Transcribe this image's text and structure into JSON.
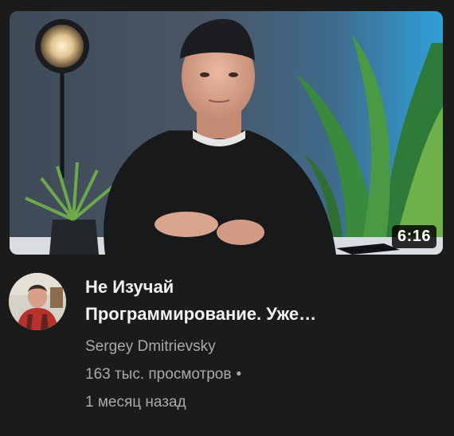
{
  "video": {
    "duration": "6:16",
    "title_line1": "Не Изучай",
    "title_line2": "Программирование. Уже…",
    "channel": "Sergey Dmitrievsky",
    "views": "163 тыс. просмотров",
    "separator": "•",
    "age": "1 месяц назад"
  },
  "colors": {
    "background": "#1b1b1b",
    "title": "#f1f1f1",
    "secondary_text": "#aaaaaa"
  }
}
